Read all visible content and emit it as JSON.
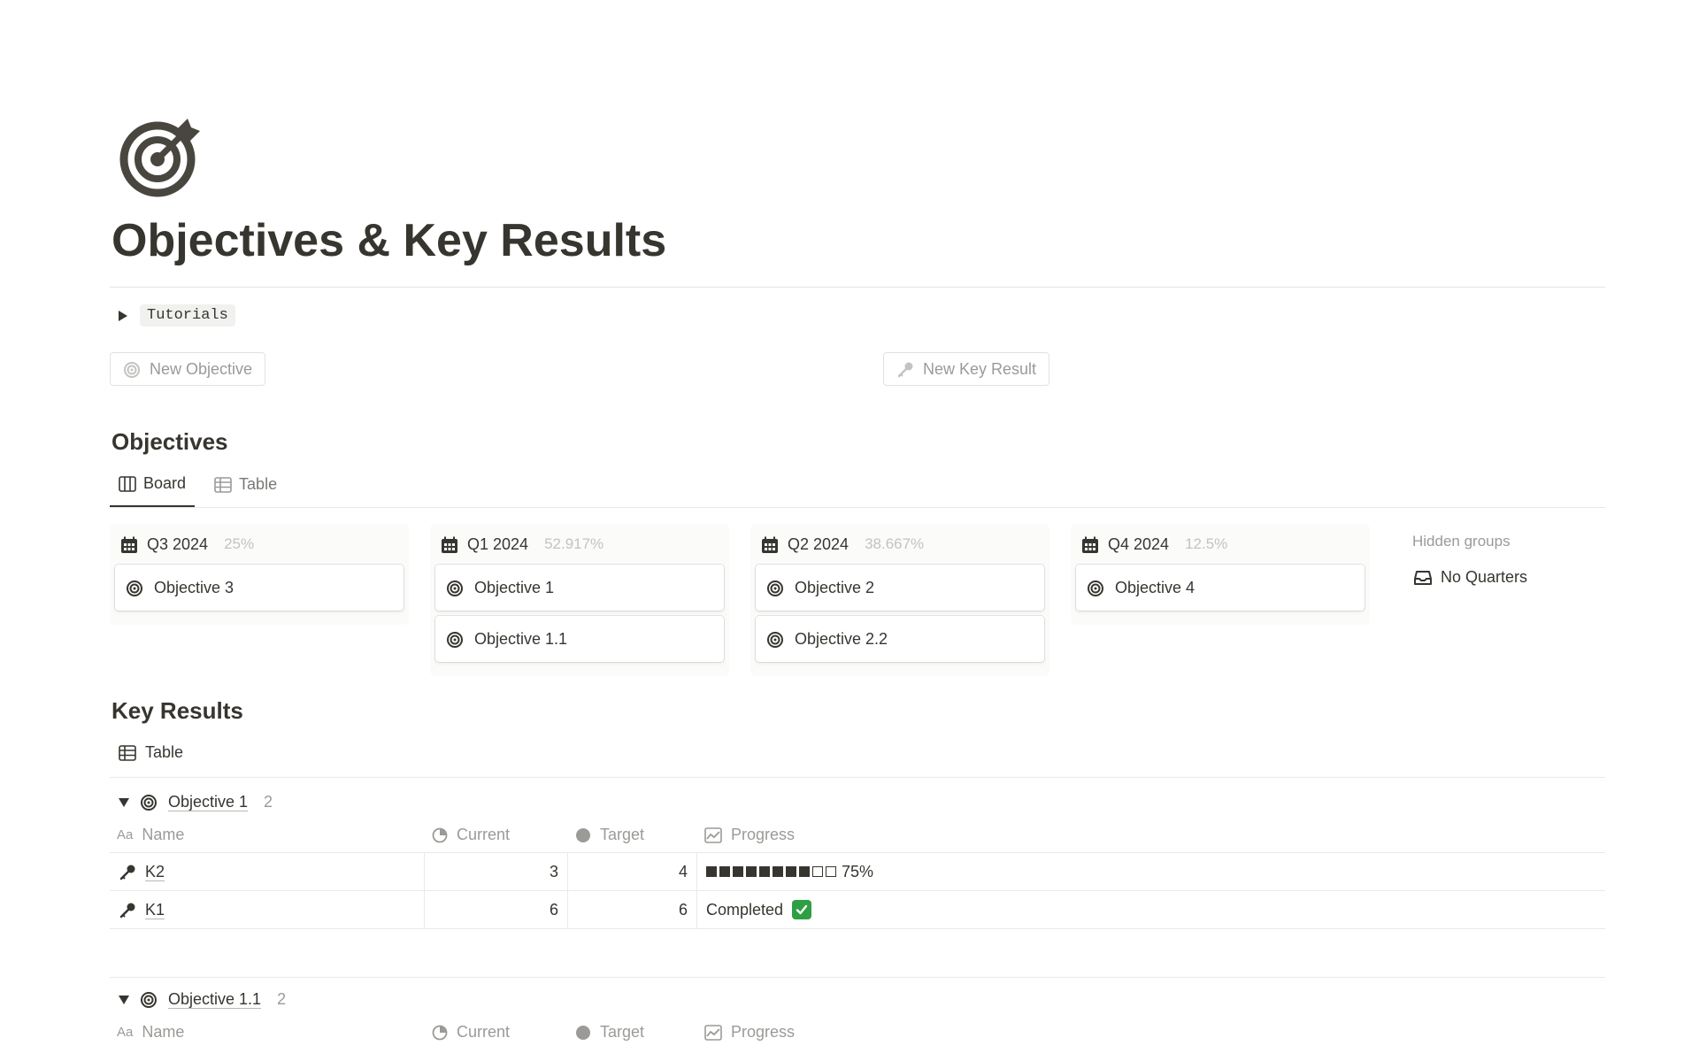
{
  "page": {
    "title": "Objectives & Key Results",
    "icon": "target-icon"
  },
  "tutorials": {
    "label": "Tutorials"
  },
  "buttons": {
    "new_objective": "New Objective",
    "new_key_result": "New Key Result"
  },
  "objectives": {
    "title": "Objectives",
    "tabs": [
      {
        "label": "Board",
        "icon": "board-icon",
        "active": true
      },
      {
        "label": "Table",
        "icon": "table-icon",
        "active": false
      }
    ],
    "columns": [
      {
        "quarter": "Q3 2024",
        "percent": "25%",
        "cards": [
          "Objective 3"
        ]
      },
      {
        "quarter": "Q1 2024",
        "percent": "52.917%",
        "cards": [
          "Objective 1",
          "Objective 1.1"
        ]
      },
      {
        "quarter": "Q2 2024",
        "percent": "38.667%",
        "cards": [
          "Objective 2",
          "Objective 2.2"
        ]
      },
      {
        "quarter": "Q4 2024",
        "percent": "12.5%",
        "cards": [
          "Objective 4"
        ]
      }
    ],
    "hidden_groups_label": "Hidden groups",
    "no_quarters_label": "No Quarters"
  },
  "key_results": {
    "title": "Key Results",
    "tab_label": "Table",
    "columns": {
      "name": "Name",
      "current": "Current",
      "target": "Target",
      "progress": "Progress",
      "name_prefix": "Aa"
    },
    "groups": [
      {
        "name": "Objective 1",
        "count": "2",
        "rows": [
          {
            "name": "K2",
            "current": "3",
            "target": "4",
            "progress_text": "75%",
            "progress_fraction": 0.75,
            "progress_squares": 10
          },
          {
            "name": "K1",
            "current": "6",
            "target": "6",
            "progress_text": "Completed",
            "completed": true
          }
        ]
      },
      {
        "name": "Objective 1.1",
        "count": "2",
        "rows": []
      }
    ]
  },
  "colors": {
    "text": "#37352f",
    "muted": "#9b9a97",
    "check_green": "#2ea043"
  }
}
